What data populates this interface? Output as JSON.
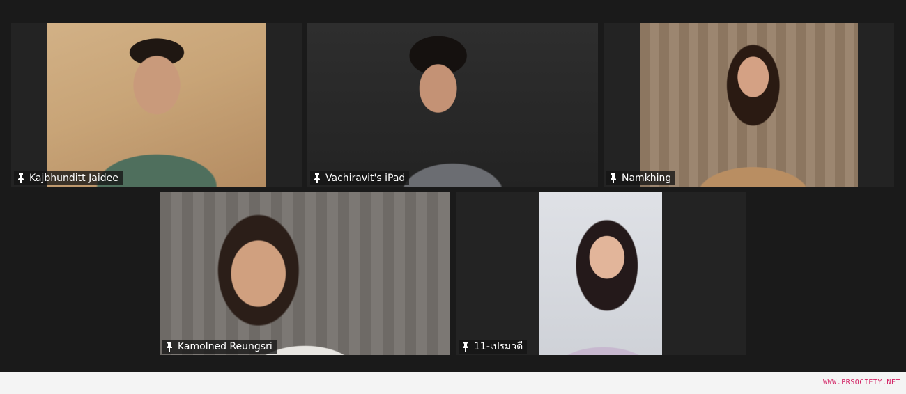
{
  "participants": [
    {
      "name": "Kajbhunditt Jaidee",
      "pinned": true
    },
    {
      "name": "Vachiravit's iPad",
      "pinned": true
    },
    {
      "name": "Namkhing",
      "pinned": true
    },
    {
      "name": "Kamolned Reungsri",
      "pinned": true
    },
    {
      "name": "11-เปรมวดี",
      "pinned": true
    }
  ],
  "icons": {
    "pin": "pin-icon"
  },
  "colors": {
    "background": "#1a1a1a",
    "tile": "#232323",
    "watermark": "#d21f62"
  },
  "watermark": "WWW.PRSOCIETY.NET"
}
